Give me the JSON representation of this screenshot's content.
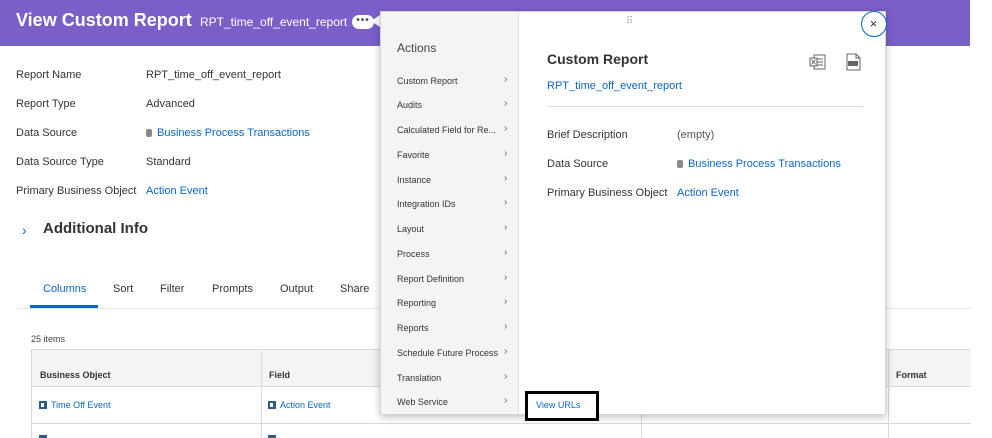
{
  "header": {
    "title": "View Custom Report",
    "subtitle": "RPT_time_off_event_report",
    "more_glyph": "•••"
  },
  "details": {
    "rows": [
      {
        "label": "Report Name",
        "value": "RPT_time_off_event_report"
      },
      {
        "label": "Report Type",
        "value": "Advanced"
      },
      {
        "label": "Data Source",
        "value": "Business Process Transactions"
      },
      {
        "label": "Data Source Type",
        "value": "Standard"
      },
      {
        "label": "Primary Business Object",
        "value": "Action Event"
      }
    ]
  },
  "additional_info": {
    "label": "Additional Info",
    "chevron": "›"
  },
  "tabs": [
    "Columns",
    "Sort",
    "Filter",
    "Prompts",
    "Output",
    "Share"
  ],
  "table": {
    "count": "25 items",
    "headers": [
      "Business Object",
      "Field",
      "Format"
    ],
    "rows": [
      {
        "business_object": "Time Off Event",
        "field": "Action Event"
      }
    ]
  },
  "popup": {
    "actions_title": "Actions",
    "menu_items": [
      "Custom Report",
      "Audits",
      "Calculated Field for Re...",
      "Favorite",
      "Instance",
      "Integration IDs",
      "Layout",
      "Process",
      "Report Definition",
      "Reporting",
      "Reports",
      "Schedule Future Process",
      "Translation",
      "Web Service"
    ],
    "menu_chevron": "›",
    "drag_glyph": "⠿",
    "right": {
      "title": "Custom Report",
      "link": "RPT_time_off_event_report",
      "fields": [
        {
          "label": "Brief Description",
          "value": "(empty)"
        },
        {
          "label": "Data Source",
          "value": "Business Process Transactions"
        },
        {
          "label": "Primary Business Object",
          "value": "Action Event"
        }
      ]
    },
    "close_glyph": "×",
    "submenu_item": "View URLs"
  },
  "icons": {
    "excel": "excel-export-icon",
    "pdf": "pdf-export-icon",
    "close": "close-icon",
    "data_source": "database-icon",
    "business_object": "business-object-icon"
  },
  "colors": {
    "header": "#7b5fc9",
    "link": "#0b66c2",
    "menu_bg": "#f4f4f4"
  }
}
